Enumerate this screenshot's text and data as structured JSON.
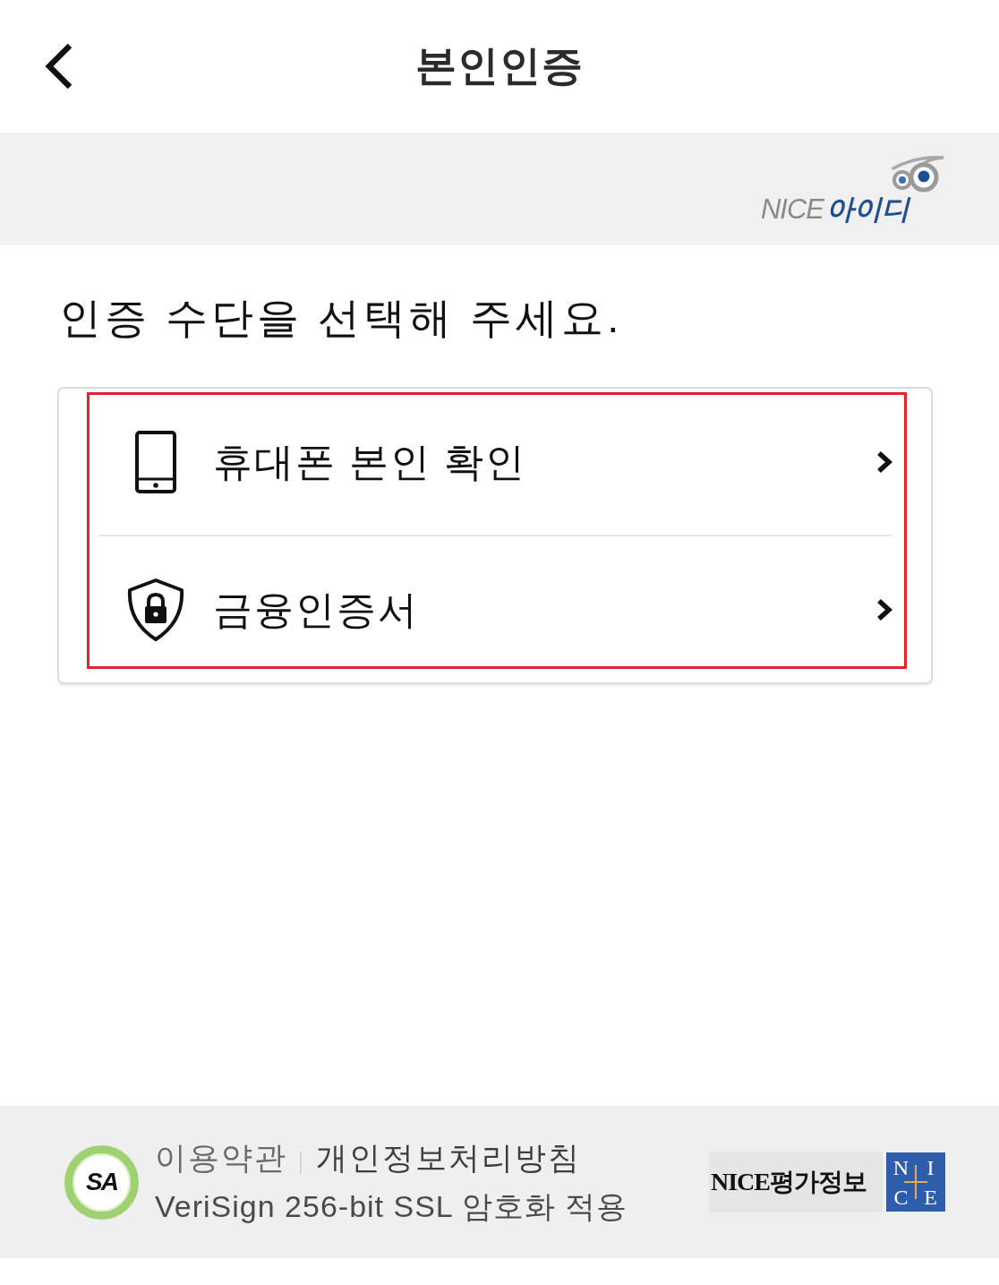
{
  "header": {
    "title": "본인인증"
  },
  "brand_band": {
    "logo_text_1": "NICE",
    "logo_text_2": "아이디"
  },
  "prompt": "인증 수단을 선택해 주세요.",
  "options_highlighted": true,
  "options": [
    {
      "kind": "phone",
      "label": "휴대폰 본인 확인"
    },
    {
      "kind": "certificate",
      "label": "금융인증서"
    }
  ],
  "footer": {
    "seal_text": "SA",
    "links": [
      {
        "label": "이용약관",
        "emphasized": false
      },
      {
        "label": "개인정보처리방침",
        "emphasized": true
      }
    ],
    "security_note": "VeriSign 256-bit SSL 암호화 적용",
    "partner_logo_text": "NICE평가정보",
    "emblem_letters": [
      "N",
      "I",
      "C",
      "E"
    ]
  }
}
